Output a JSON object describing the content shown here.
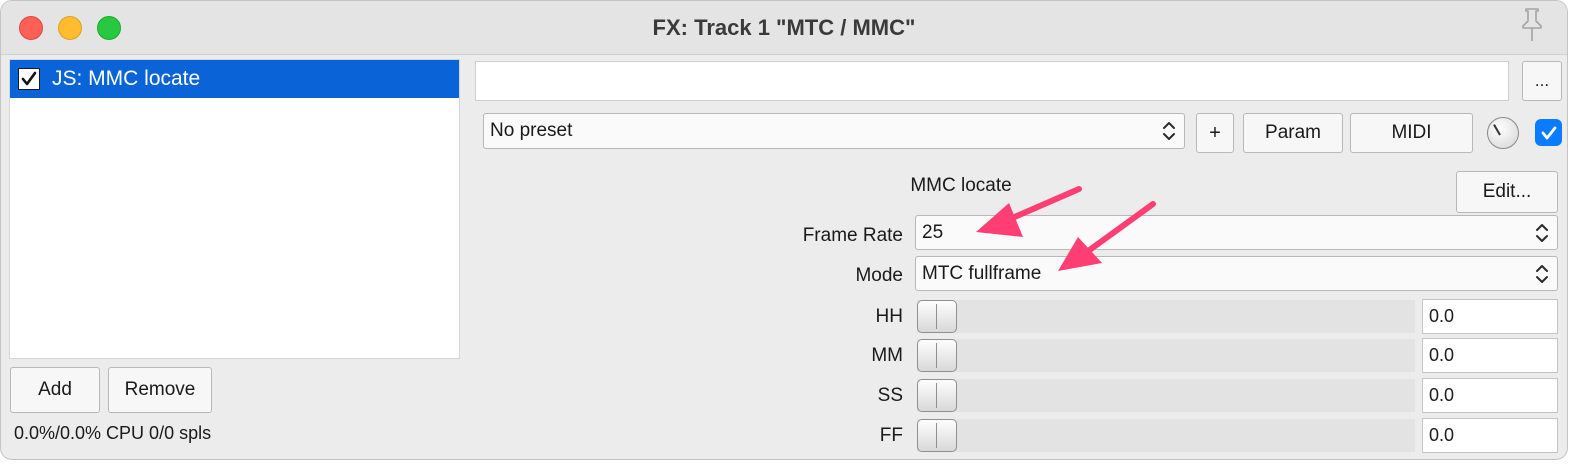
{
  "window": {
    "title": "FX: Track 1 \"MTC / MMC\""
  },
  "fx_chain": {
    "items": [
      {
        "label": "JS: MMC locate",
        "enabled": true
      }
    ],
    "add_label": "Add",
    "remove_label": "Remove",
    "status": "0.0%/0.0% CPU 0/0 spls"
  },
  "toolbar": {
    "more_label": "...",
    "preset": "No preset",
    "plus_label": "+",
    "param_label": "Param",
    "midi_label": "MIDI"
  },
  "plugin": {
    "name": "MMC locate",
    "edit_label": "Edit...",
    "frame_rate": {
      "label": "Frame Rate",
      "value": "25"
    },
    "mode": {
      "label": "Mode",
      "value": "MTC fullframe"
    },
    "sliders": [
      {
        "label": "HH",
        "value": "0.0"
      },
      {
        "label": "MM",
        "value": "0.0"
      },
      {
        "label": "SS",
        "value": "0.0"
      },
      {
        "label": "FF",
        "value": "0.0"
      }
    ]
  },
  "colors": {
    "selection": "#0a64d8",
    "annotation_arrow": "#ff3f74"
  }
}
